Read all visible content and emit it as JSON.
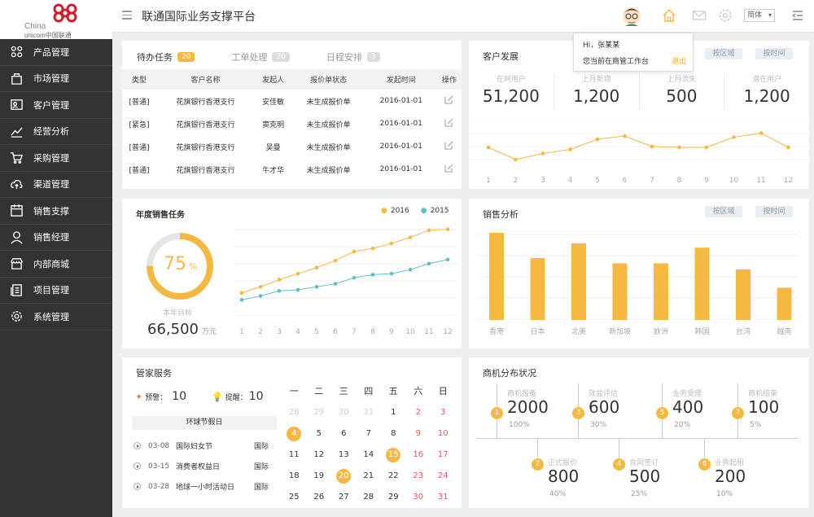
{
  "app": {
    "title": "联通国际业务支撑平台",
    "logo_text_1": "China",
    "logo_text_2": "unicom中国联通"
  },
  "sidebar": {
    "items": [
      {
        "label": "产品管理",
        "icon": "network-icon"
      },
      {
        "label": "市场管理",
        "icon": "bag-icon"
      },
      {
        "label": "客户管理",
        "icon": "contact-card-icon"
      },
      {
        "label": "经营分析",
        "icon": "trend-icon"
      },
      {
        "label": "采购管理",
        "icon": "cart-icon"
      },
      {
        "label": "渠道管理",
        "icon": "cloud-upload-icon"
      },
      {
        "label": "销售支撑",
        "icon": "calendar-icon"
      },
      {
        "label": "销售经理",
        "icon": "user-icon"
      },
      {
        "label": "内部商城",
        "icon": "store-icon"
      },
      {
        "label": "项目管理",
        "icon": "document-icon"
      },
      {
        "label": "系统管理",
        "icon": "gear-icon"
      }
    ]
  },
  "topbar": {
    "lang": "简体",
    "lang_arrow": "▾"
  },
  "popup": {
    "greeting": "Hi，张某某",
    "info": "您当前在商管工作台",
    "logout": "退出"
  },
  "tasks": {
    "tabs": [
      {
        "label": "待办任务",
        "count": "20"
      },
      {
        "label": "工单处理",
        "count": "20"
      },
      {
        "label": "日程安排",
        "count": "3"
      }
    ],
    "headers": [
      "类型",
      "客户名称",
      "发起人",
      "报价单状态",
      "发起时间",
      "操作"
    ],
    "rows": [
      [
        "[普通]",
        "花旗银行香港支行",
        "安佳敏",
        "未生成报价单",
        "2016-01-01"
      ],
      [
        "[紧急]",
        "花旗银行香港支行",
        "窦克明",
        "未生成报价单",
        "2016-01-01"
      ],
      [
        "[普通]",
        "花旗银行香港支行",
        "吴曼",
        "未生成报价单",
        "2016-01-01"
      ],
      [
        "[普通]",
        "花旗银行香港支行",
        "牛才华",
        "未生成报价单",
        "2016-01-01"
      ]
    ]
  },
  "customer": {
    "title": "客户发展",
    "btn_region": "按区域",
    "btn_time": "按时间",
    "stats": [
      {
        "label": "在网用户",
        "value": "51,200"
      },
      {
        "label": "上月新增",
        "value": "1,200"
      },
      {
        "label": "上月流失",
        "value": "500"
      },
      {
        "label": "潜在用户",
        "value": "1,200"
      }
    ]
  },
  "annual": {
    "title": "年度销售任务",
    "legend": [
      "2016",
      "2015"
    ],
    "percent": "75",
    "percent_unit": "%",
    "target_label": "本年目标",
    "target_value": "66,500",
    "target_unit": "万元"
  },
  "sales": {
    "title": "销售分析",
    "btn_region": "按区域",
    "btn_time": "按时间"
  },
  "butler": {
    "title": "管家服务",
    "warn_label": "预警：",
    "warn_value": "10",
    "remind_label": "提醒：",
    "remind_value": "10",
    "holiday_header": "环球节假日",
    "holidays": [
      {
        "date": "03-08",
        "name": "国际妇女节",
        "scope": "国际"
      },
      {
        "date": "03-15",
        "name": "消费者权益日",
        "scope": "国际"
      },
      {
        "date": "03-28",
        "name": "地球一小时活动日",
        "scope": "国际"
      }
    ],
    "weekdays": [
      "一",
      "二",
      "三",
      "四",
      "五",
      "六",
      "日"
    ],
    "calendar": [
      [
        {
          "d": "28",
          "c": "dim"
        },
        {
          "d": "29",
          "c": "dim"
        },
        {
          "d": "30",
          "c": "dim"
        },
        {
          "d": "31",
          "c": "dim"
        },
        {
          "d": "1",
          "c": ""
        },
        {
          "d": "2",
          "c": "red"
        },
        {
          "d": "3",
          "c": "red"
        }
      ],
      [
        {
          "d": "4",
          "c": "hl"
        },
        {
          "d": "5",
          "c": ""
        },
        {
          "d": "6",
          "c": ""
        },
        {
          "d": "7",
          "c": ""
        },
        {
          "d": "8",
          "c": ""
        },
        {
          "d": "9",
          "c": "red"
        },
        {
          "d": "10",
          "c": "red"
        }
      ],
      [
        {
          "d": "11",
          "c": ""
        },
        {
          "d": "12",
          "c": ""
        },
        {
          "d": "13",
          "c": ""
        },
        {
          "d": "14",
          "c": ""
        },
        {
          "d": "15",
          "c": "hl"
        },
        {
          "d": "16",
          "c": "red"
        },
        {
          "d": "17",
          "c": "red"
        }
      ],
      [
        {
          "d": "18",
          "c": ""
        },
        {
          "d": "19",
          "c": ""
        },
        {
          "d": "20",
          "c": "hl"
        },
        {
          "d": "21",
          "c": ""
        },
        {
          "d": "22",
          "c": ""
        },
        {
          "d": "23",
          "c": "red"
        },
        {
          "d": "24",
          "c": "red"
        }
      ],
      [
        {
          "d": "25",
          "c": ""
        },
        {
          "d": "26",
          "c": ""
        },
        {
          "d": "27",
          "c": ""
        },
        {
          "d": "28",
          "c": ""
        },
        {
          "d": "29",
          "c": ""
        },
        {
          "d": "30",
          "c": "red"
        },
        {
          "d": "31",
          "c": "red"
        }
      ]
    ]
  },
  "opportunity": {
    "title": "商机分布状况",
    "items": [
      {
        "n": "1",
        "label": "商机报备",
        "value": "2000",
        "pct": "100%"
      },
      {
        "n": "3",
        "label": "效益评估",
        "value": "600",
        "pct": "30%"
      },
      {
        "n": "5",
        "label": "业务受理",
        "value": "400",
        "pct": "20%"
      },
      {
        "n": "7",
        "label": "商机结束",
        "value": "100",
        "pct": "5%"
      },
      {
        "n": "2",
        "label": "正式报价",
        "value": "800",
        "pct": "40%"
      },
      {
        "n": "4",
        "label": "合同签订",
        "value": "500",
        "pct": "25%"
      },
      {
        "n": "6",
        "label": "业务起租",
        "value": "200",
        "pct": "10%"
      }
    ]
  },
  "chart_data": [
    {
      "type": "line",
      "categories": [
        "1",
        "2",
        "3",
        "4",
        "5",
        "6",
        "7",
        "8",
        "9",
        "10",
        "11",
        "12"
      ],
      "series": [
        {
          "values": [
            0.5,
            0.2,
            0.35,
            0.45,
            0.7,
            0.78,
            0.52,
            0.5,
            0.5,
            0.75,
            0.85,
            0.5
          ]
        }
      ],
      "color": "#f5b942"
    },
    {
      "type": "line",
      "categories": [
        "1",
        "2",
        "3",
        "4",
        "5",
        "6",
        "7",
        "8",
        "9",
        "10",
        "11",
        "12"
      ],
      "series": [
        {
          "name": "2016",
          "values": [
            22,
            28,
            35,
            41,
            47,
            54,
            63,
            66,
            71,
            77,
            84,
            85
          ]
        },
        {
          "name": "2015",
          "values": [
            15,
            19,
            24,
            25,
            28,
            31,
            37,
            40,
            41,
            45,
            51,
            55
          ]
        }
      ],
      "colors": [
        "#f5b942",
        "#5bc0c7"
      ],
      "ylim": [
        0,
        100
      ]
    },
    {
      "type": "bar",
      "categories": [
        "香港",
        "日本",
        "北美",
        "新加坡",
        "欧洲",
        "韩国",
        "台湾",
        "越南"
      ],
      "values": [
        100,
        71,
        88,
        65,
        65,
        83,
        58,
        37
      ],
      "ylim": [
        0,
        110
      ],
      "color": "#f5b942"
    }
  ]
}
